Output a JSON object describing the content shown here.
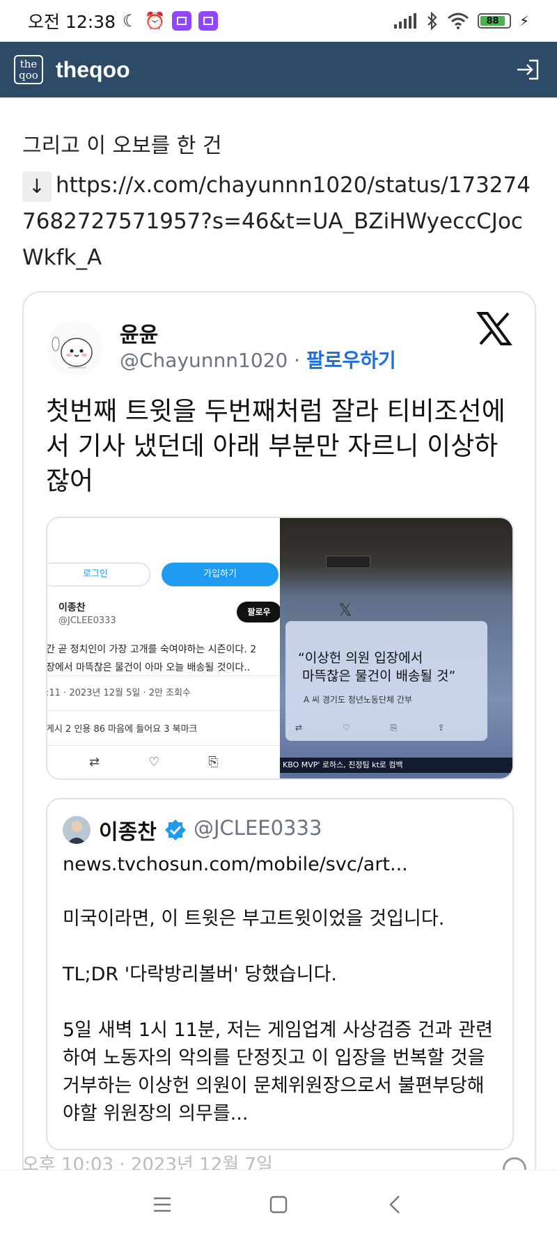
{
  "status_bar": {
    "time": "오전 12:38",
    "battery": "88"
  },
  "app": {
    "title": "theqoo",
    "logo_text_top": "the",
    "logo_text_bottom": "qoo"
  },
  "post": {
    "line1": "그리고 이 오보를 한 건",
    "arrow": "↓",
    "link": "https://x.com/chayunnn1020/status/1732747682727571957?s=46&t=UA_BZiHWyeccCJocWkfk_A"
  },
  "tweet": {
    "author_name": "윤윤",
    "author_handle": "@Chayunnn1020",
    "separator": " · ",
    "follow_label": "팔로우하기",
    "text": "첫번째 트윗을 두번째처럼 잘라 티비조선에서 기사 냈던데 아래 부분만 자르니 이상하잖어",
    "media_left": {
      "login": "로그인",
      "join": "가입하기",
      "name": "이종찬",
      "handle": "@JCLEE0333",
      "follow": "팔로우",
      "body1": "간 곧 정치인이 가장 고개를 숙여야하는 시즌이다. 2",
      "body2": "장에서 마뜩찮은 물건이 아마 오늘 배송될 것이다..",
      "time": ":11 · 2023년 12월 5일 · 2만 조회수",
      "stats": "게시   2 인용   86 마음에 들어요   3 북마크"
    },
    "media_right": {
      "quote": "“이상헌 의원 입장에서\n 마뜩찮은 물건이 배송될 것”",
      "caption": "A 씨  경기도 청년노동단체 간부",
      "ticker": "KBO MVP' 로하스, 친정팀 kt로 컴백"
    }
  },
  "quoted_tweet": {
    "name": "이종찬",
    "handle": "@JCLEE0333",
    "link": "news.tvchosun.com/mobile/svc/art...",
    "paragraphs": [
      "미국이라면, 이 트윗은 부고트윗이었을 것입니다.",
      "TL;DR '다락방리볼버' 당했습니다.",
      "5일 새벽 1시 11분, 저는 게임업계 사상검증 건과 관련하여 노동자의 악의를 단정짓고 이 입장을 번복할 것을 거부하는 이상헌 의원이 문체위원장으로서 불편부당해야할 위원장의 의무를..."
    ]
  },
  "cut_line": "오후 10:03 · 2023년 12월 7일"
}
